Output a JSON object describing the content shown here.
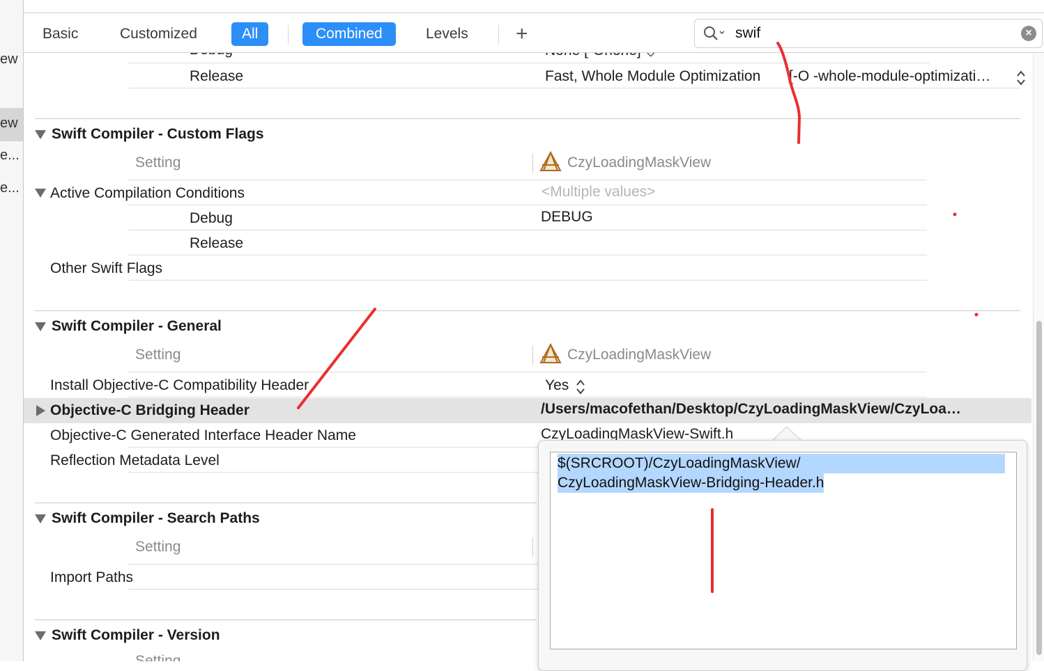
{
  "sidebar": {
    "fragments": [
      "ew",
      "ew",
      "e...",
      "e..."
    ]
  },
  "toolbar": {
    "basic": "Basic",
    "customized": "Customized",
    "all": "All",
    "combined": "Combined",
    "levels": "Levels",
    "add": "+",
    "search_value": "swif",
    "search_icon": "magnifier-icon",
    "clear_icon": "clear-icon"
  },
  "top": {
    "debug_clipped": "Debug",
    "debug_value_clipped": "None [-Onone] ◇",
    "release": "Release",
    "release_value": "Fast, Whole Module Optimization",
    "release_flag": "[-O -whole-module-optimizati…"
  },
  "custom_flags": {
    "title": "Swift Compiler - Custom Flags",
    "setting": "Setting",
    "target": "CzyLoadingMaskView",
    "active_conditions": "Active Compilation Conditions",
    "multiple": "<Multiple values>",
    "debug": "Debug",
    "debug_value": "DEBUG",
    "release": "Release",
    "other_flags": "Other Swift Flags"
  },
  "general": {
    "title": "Swift Compiler - General",
    "setting": "Setting",
    "target": "CzyLoadingMaskView",
    "install_header": "Install Objective-C Compatibility Header",
    "install_value": "Yes",
    "bridging": "Objective-C Bridging Header",
    "bridging_value": "/Users/macofethan/Desktop/CzyLoadingMaskView/CzyLoa…",
    "generated_name": "Objective-C Generated Interface Header Name",
    "generated_value": "CzyLoadingMaskView-Swift.h",
    "reflection": "Reflection Metadata Level"
  },
  "search_paths": {
    "title": "Swift Compiler - Search Paths",
    "setting": "Setting",
    "import_paths": "Import Paths"
  },
  "version": {
    "title": "Swift Compiler - Version",
    "setting_clipped": "Setting"
  },
  "popover": {
    "line1": "$(SRCROOT)/CzyLoadingMaskView/",
    "line2": "CzyLoadingMaskView-Bridging-Header.h"
  },
  "colors": {
    "accent": "#2c8ff7",
    "selection": "#b3d7ff",
    "annotation": "#e8302e"
  }
}
